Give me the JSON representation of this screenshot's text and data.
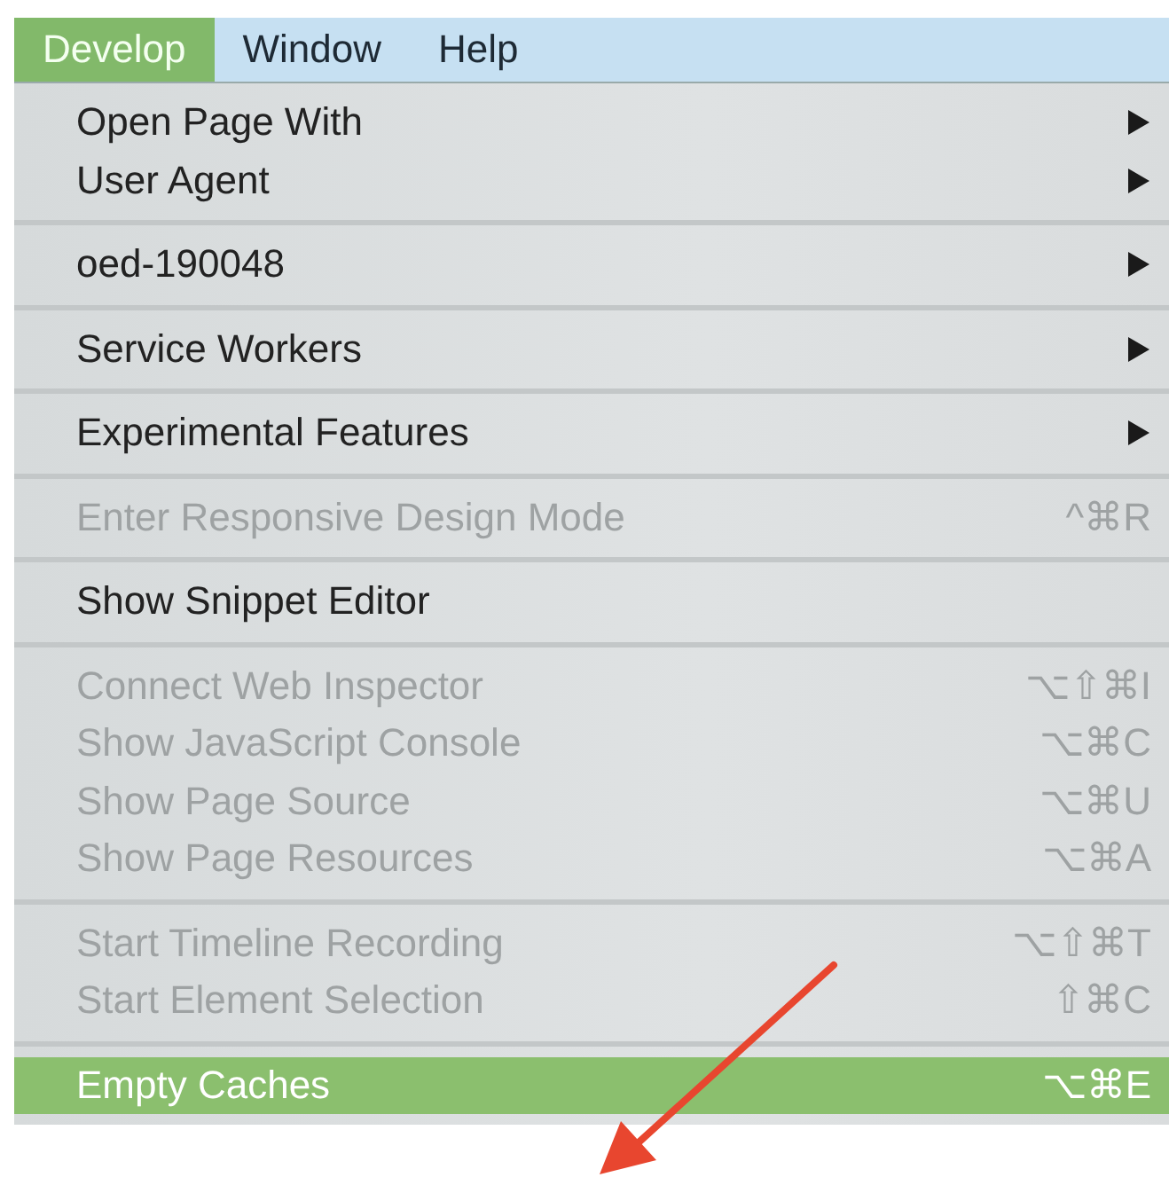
{
  "menubar": [
    {
      "label": "Develop",
      "selected": true
    },
    {
      "label": "Window",
      "selected": false
    },
    {
      "label": "Help",
      "selected": false
    }
  ],
  "menu": {
    "groups": [
      {
        "items": [
          {
            "label": "Open Page With",
            "submenu": true,
            "disabled": false,
            "selected": false
          },
          {
            "label": "User Agent",
            "submenu": true,
            "disabled": false,
            "selected": false
          }
        ]
      },
      {
        "items": [
          {
            "label": "oed-190048",
            "submenu": true,
            "disabled": false,
            "selected": false
          }
        ]
      },
      {
        "items": [
          {
            "label": "Service Workers",
            "submenu": true,
            "disabled": false,
            "selected": false
          }
        ]
      },
      {
        "items": [
          {
            "label": "Experimental Features",
            "submenu": true,
            "disabled": false,
            "selected": false
          }
        ]
      },
      {
        "items": [
          {
            "label": "Enter Responsive Design Mode",
            "shortcut": "^⌘R",
            "submenu": false,
            "disabled": true,
            "selected": false
          }
        ]
      },
      {
        "items": [
          {
            "label": "Show Snippet Editor",
            "submenu": false,
            "disabled": false,
            "selected": false
          }
        ]
      },
      {
        "items": [
          {
            "label": "Connect Web Inspector",
            "shortcut": "⌥⇧⌘I",
            "submenu": false,
            "disabled": true,
            "selected": false
          },
          {
            "label": "Show JavaScript Console",
            "shortcut": "⌥⌘C",
            "submenu": false,
            "disabled": true,
            "selected": false
          },
          {
            "label": "Show Page Source",
            "shortcut": "⌥⌘U",
            "submenu": false,
            "disabled": true,
            "selected": false
          },
          {
            "label": "Show Page Resources",
            "shortcut": "⌥⌘A",
            "submenu": false,
            "disabled": true,
            "selected": false
          }
        ]
      },
      {
        "items": [
          {
            "label": "Start Timeline Recording",
            "shortcut": "⌥⇧⌘T",
            "submenu": false,
            "disabled": true,
            "selected": false
          },
          {
            "label": "Start Element Selection",
            "shortcut": "⇧⌘C",
            "submenu": false,
            "disabled": true,
            "selected": false
          }
        ]
      },
      {
        "items": [
          {
            "label": "Empty Caches",
            "shortcut": "⌥⌘E",
            "submenu": false,
            "disabled": false,
            "selected": true
          }
        ]
      }
    ]
  }
}
